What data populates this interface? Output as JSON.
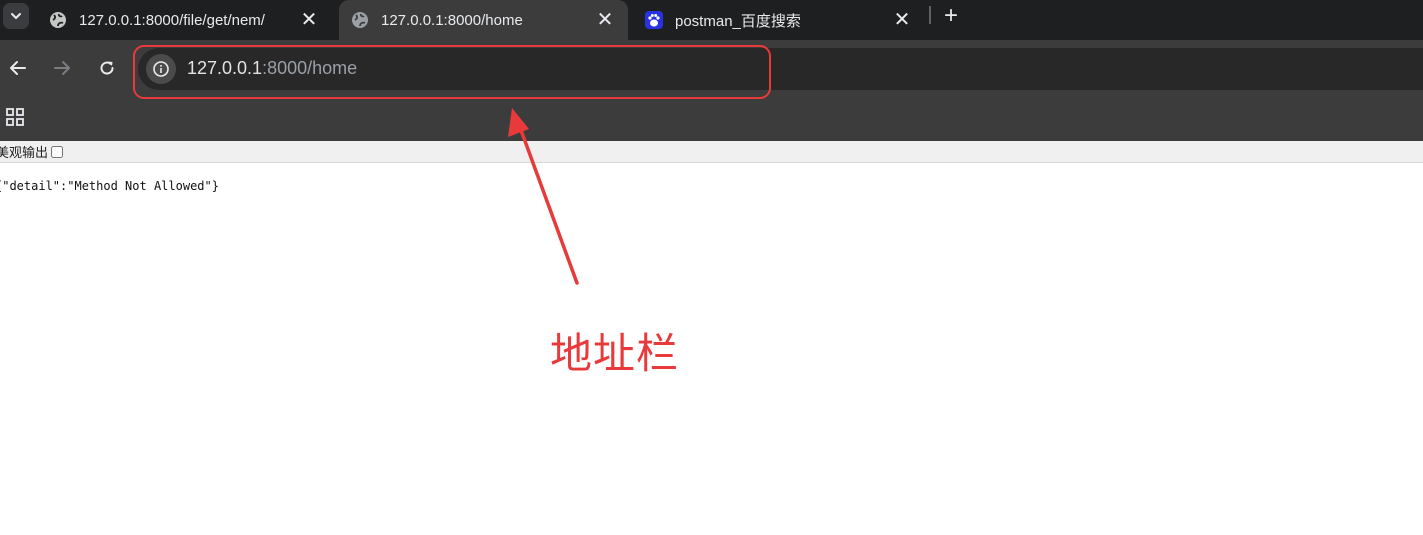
{
  "tabs": [
    {
      "title": "127.0.0.1:8000/file/get/nem/",
      "favicon": "globe-icon",
      "active": false
    },
    {
      "title": "127.0.0.1:8000/home",
      "favicon": "globe-icon",
      "active": true
    },
    {
      "title": "postman_百度搜索",
      "favicon": "baidu-paw-icon",
      "active": false
    }
  ],
  "address_bar": {
    "host": "127.0.0.1",
    "port_path": ":8000/home"
  },
  "page": {
    "pretty_print_label": "美观输出",
    "pretty_print_checked": false,
    "json_text": "{\"detail\":\"Method Not Allowed\"}"
  },
  "annotation": {
    "label": "地址栏",
    "color": "#e83a3a"
  },
  "colors": {
    "tabstrip": "#1e1f20",
    "toolbar": "#3c3c3c",
    "omnibox": "#282828",
    "baidu_blue": "#2932e1"
  }
}
